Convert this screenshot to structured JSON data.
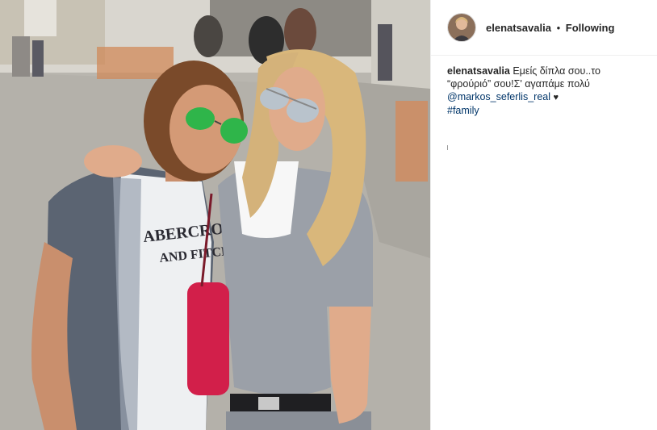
{
  "post": {
    "username": "elenatsavalia",
    "separator": "•",
    "follow_state": "Following"
  },
  "caption": {
    "username": "elenatsavalia",
    "line1_text": "Εμείς δίπλα σου..το",
    "line2_text": "“φρούριό” σου!Σ' αγαπάμε πολύ",
    "mention": "@markos_seferlis_real",
    "heart": "♥",
    "hashtag": "#family"
  },
  "photo": {
    "shirt_print_line1": "ABERCROMB",
    "shirt_print_line2": "AND FITCH"
  },
  "colors": {
    "link": "#003569",
    "text": "#262626",
    "divider": "#efefef"
  },
  "icons": {
    "avatar": "profile-avatar",
    "heart": "heart-icon"
  }
}
